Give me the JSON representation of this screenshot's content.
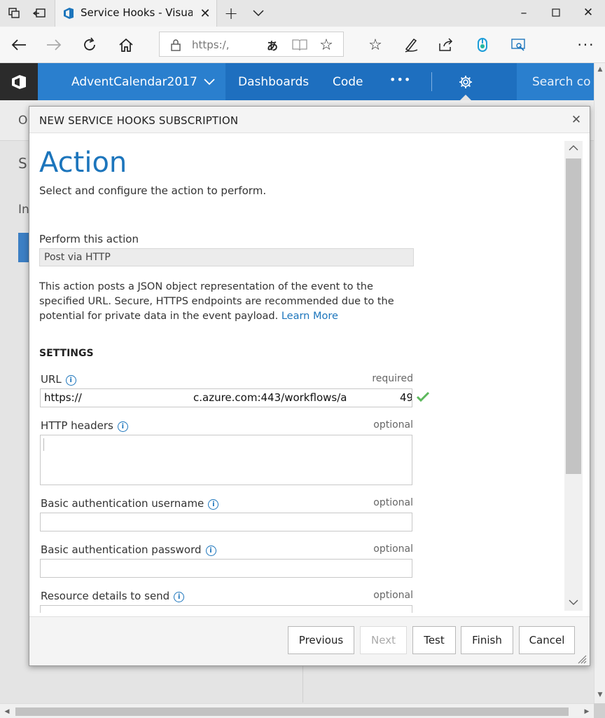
{
  "browser": {
    "tab_title": "Service Hooks - Visual S",
    "address": "https:/,"
  },
  "vsts": {
    "project": "AdventCalendar2017",
    "nav": [
      "Dashboards",
      "Code"
    ],
    "more": "•••",
    "search_placeholder": "Search co"
  },
  "background": {
    "letters": [
      "O",
      "S",
      "In"
    ]
  },
  "dialog": {
    "title": "NEW SERVICE HOOKS SUBSCRIPTION",
    "heading": "Action",
    "subheading": "Select and configure the action to perform.",
    "perform_label": "Perform this action",
    "perform_value": "Post via HTTP",
    "description": "This action posts a JSON object representation of the event to the specified URL. Secure, HTTPS endpoints are recommended due to the potential for private data in the event payload.",
    "learn_more": "Learn More",
    "settings_heading": "SETTINGS",
    "fields": {
      "url": {
        "label": "URL",
        "hint": "required",
        "value_start": "https://",
        "value_mid": "c.azure.com:443/workflows/a",
        "value_end": "49"
      },
      "headers": {
        "label": "HTTP headers",
        "hint": "optional"
      },
      "username": {
        "label": "Basic authentication username",
        "hint": "optional"
      },
      "password": {
        "label": "Basic authentication password",
        "hint": "optional"
      },
      "resource": {
        "label": "Resource details to send",
        "hint": "optional"
      }
    },
    "buttons": {
      "previous": "Previous",
      "next": "Next",
      "test": "Test",
      "finish": "Finish",
      "cancel": "Cancel"
    }
  },
  "colors": {
    "accent": "#1c75bc",
    "header": "#1e6fbf",
    "valid": "#5cb85c"
  }
}
